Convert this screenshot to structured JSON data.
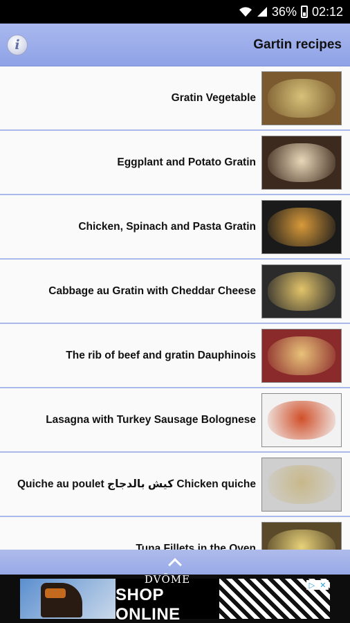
{
  "status_bar": {
    "battery_percent": "36%",
    "time": "02:12",
    "icons": [
      "wifi-icon",
      "signal-icon",
      "battery-icon"
    ]
  },
  "header": {
    "info_icon": "info-icon",
    "info_glyph": "i",
    "title": "Gartin recipes"
  },
  "recipes": [
    {
      "title": "Gratin Vegetable",
      "thumb_colors": [
        "#7a5a2e",
        "#d6c27a"
      ]
    },
    {
      "title": "Eggplant and Potato Gratin",
      "thumb_colors": [
        "#3d2a1e",
        "#e8d8b8"
      ]
    },
    {
      "title": "Chicken, Spinach and Pasta Gratin",
      "thumb_colors": [
        "#1a1a1a",
        "#d89a3a"
      ]
    },
    {
      "title": "Cabbage au Gratin with Cheddar Cheese",
      "thumb_colors": [
        "#2b2b2b",
        "#e3c46a"
      ]
    },
    {
      "title": "The rib of beef and gratin Dauphinois",
      "thumb_colors": [
        "#8a2a2a",
        "#e8c27a"
      ]
    },
    {
      "title": "Lasagna with Turkey Sausage Bolognese",
      "thumb_colors": [
        "#f2f2f2",
        "#d0502a"
      ]
    },
    {
      "title": "Quiche au poulet كيش بالدجاج Chicken quiche",
      "thumb_colors": [
        "#cfcfcf",
        "#c8b88a"
      ]
    },
    {
      "title": "Tuna Fillets in the Oven",
      "thumb_colors": [
        "#5a4a2a",
        "#e8d27a"
      ]
    }
  ],
  "scroll_up_icon": "chevron-up-icon",
  "ad": {
    "brand": "DVŌME",
    "cta": "SHOP ONLINE",
    "badge_icons": [
      "adchoices-icon",
      "close-icon"
    ]
  }
}
